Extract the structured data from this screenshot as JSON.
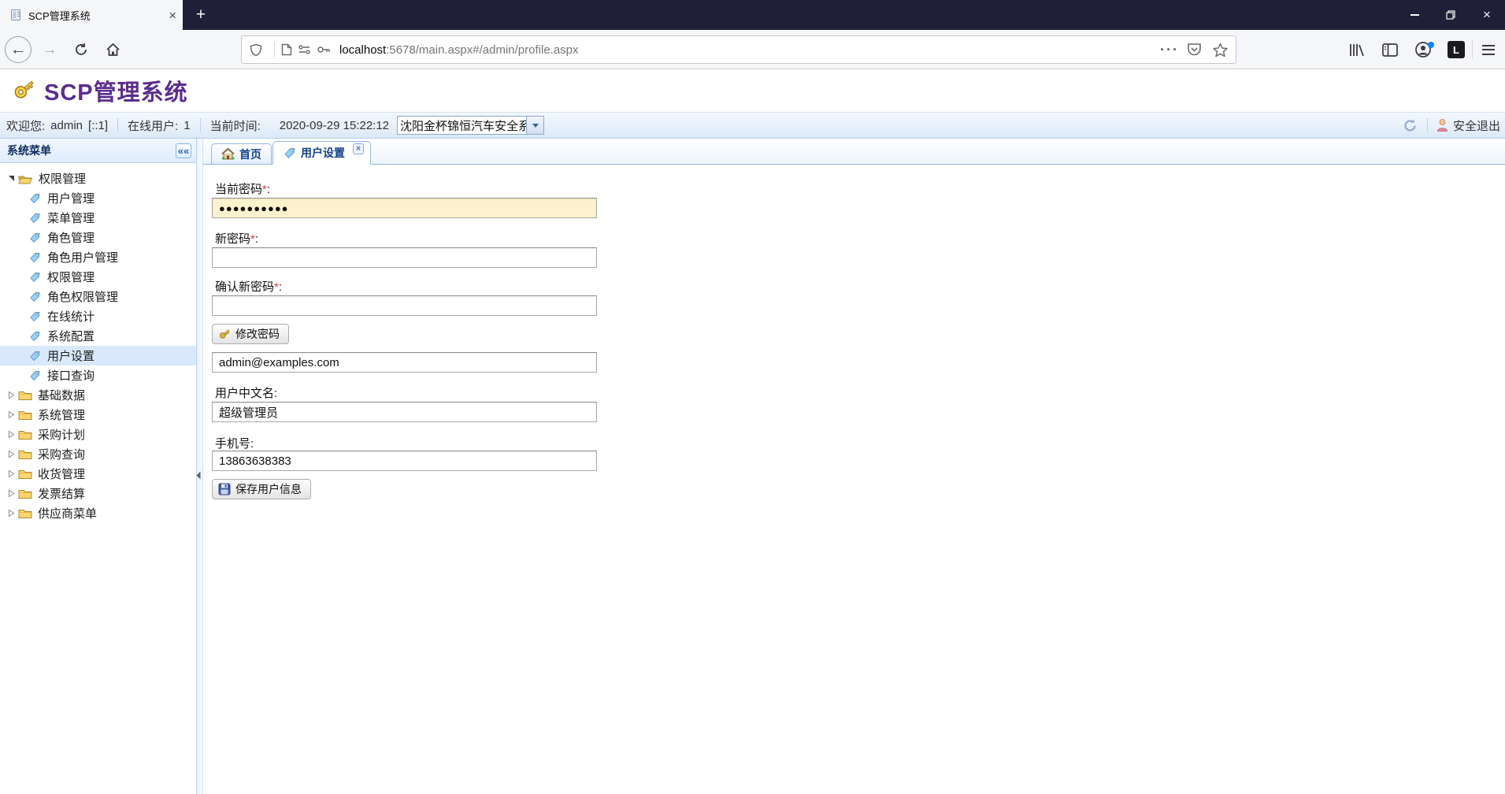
{
  "browser": {
    "tab_title": "SCP管理系统",
    "tab_close": "×",
    "new_tab": "+",
    "window_close": "×",
    "url_host": "localhost",
    "url_path": ":5678/main.aspx#/admin/profile.aspx",
    "page_actions_dots": "···"
  },
  "app": {
    "title": "SCP管理系统",
    "welcome": {
      "greeting_label": "欢迎您:",
      "user": "admin",
      "ip": "[::1]",
      "online_label": "在线用户:",
      "online_count": "1",
      "time_label": "当前时间:",
      "time": "2020-09-29 15:22:12",
      "company": "沈阳金杯锦恒汽车安全系",
      "logout": "安全退出"
    },
    "sidebar": {
      "title": "系统菜单",
      "collapse_glyph": "«",
      "tree": [
        {
          "label": "权限管理"
        },
        {
          "label": "用户管理"
        },
        {
          "label": "菜单管理"
        },
        {
          "label": "角色管理"
        },
        {
          "label": "角色用户管理"
        },
        {
          "label": "权限管理"
        },
        {
          "label": "角色权限管理"
        },
        {
          "label": "在线统计"
        },
        {
          "label": "系统配置"
        },
        {
          "label": "用户设置"
        },
        {
          "label": "接口查询"
        },
        {
          "label": "基础数据"
        },
        {
          "label": "系统管理"
        },
        {
          "label": "采购计划"
        },
        {
          "label": "采购查询"
        },
        {
          "label": "收货管理"
        },
        {
          "label": "发票结算"
        },
        {
          "label": "供应商菜单"
        }
      ]
    },
    "tabs": {
      "home": "首页",
      "active": "用户设置",
      "close_glyph": "×"
    },
    "form": {
      "required_mark": "*",
      "colon": ":",
      "current_pwd_label": "当前密码",
      "current_pwd_value": "●●●●●●●●●●",
      "new_pwd_label": "新密码",
      "new_pwd_value": "",
      "confirm_pwd_label": "确认新密码",
      "confirm_pwd_value": "",
      "change_pwd_button": "修改密码",
      "email_value": "admin@examples.com",
      "cn_name_label": "用户中文名",
      "cn_name_value": "超级管理员",
      "phone_label": "手机号",
      "phone_value": "13863638383",
      "save_button": "保存用户信息"
    },
    "colors": {
      "accent_purple": "#5b2d90",
      "panel_border": "#95b8e7",
      "selected_row": "#d9e8fb",
      "password_field_bg": "#fcf2cd",
      "browser_bar": "#1f1f38"
    }
  }
}
